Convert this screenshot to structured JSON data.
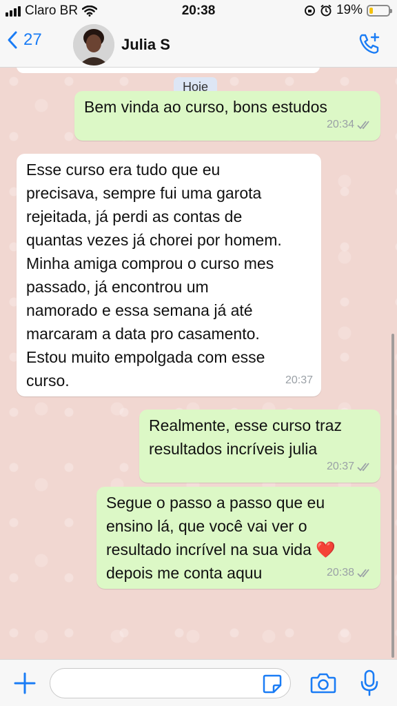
{
  "status_bar": {
    "carrier": "Claro BR",
    "time": "20:38",
    "battery_text": "19%",
    "battery_level": 0.19,
    "battery_color": "#f4c20d"
  },
  "header": {
    "back_count": "27",
    "back_icon": "chevron-left-icon",
    "contact_name": "Julia S",
    "call_icon": "phone-add-icon"
  },
  "chat": {
    "date_label": "Hoje",
    "messages": [
      {
        "direction": "out",
        "text": "Bem vinda ao curso, bons estudos",
        "time": "20:34",
        "status": "read"
      },
      {
        "direction": "in",
        "text": "Esse curso era tudo que eu\nprecisava, sempre fui uma garota\nrejeitada, já perdi as contas de\nquantas vezes já chorei por homem.\nMinha amiga comprou o curso mes\npassado, já encontrou um\nnamorado e essa semana já até\nmarcaram a data pro casamento.\nEstou muito empolgada com esse\ncurso.",
        "time": "20:37"
      },
      {
        "direction": "out",
        "text": "Realmente, esse curso traz\nresultados incríveis julia",
        "time": "20:37",
        "status": "read"
      },
      {
        "direction": "out",
        "text": "Segue o passo a passo que eu\nensino lá, que você vai ver o\nresultado incrível na sua vida ❤️\ndepois me conta aquu",
        "time": "20:38",
        "status": "read"
      }
    ]
  },
  "input_bar": {
    "placeholder": "",
    "icons": [
      "plus-icon",
      "sticker-icon",
      "camera-icon",
      "microphone-icon"
    ],
    "accent": "#1a7cf5"
  },
  "colors": {
    "outgoing_bubble": "#dcf8c6",
    "incoming_bubble": "#ffffff",
    "chat_background": "#f1d7d1"
  }
}
